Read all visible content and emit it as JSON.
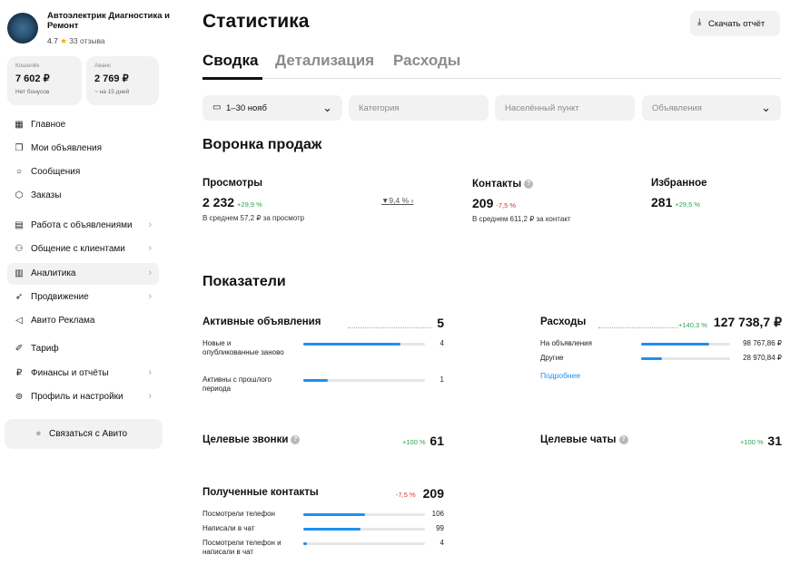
{
  "profile": {
    "name": "Автоэлектрик Диагностика и Ремонт",
    "rating": "4.7",
    "reviews": "33 отзыва"
  },
  "wallets": [
    {
      "label": "Кошелёк",
      "value": "7 602 ₽",
      "sub": "Нет бонусов"
    },
    {
      "label": "Аванс",
      "value": "2 769 ₽",
      "sub": "~ на 15 дней"
    }
  ],
  "nav": [
    {
      "label": "Главное",
      "icon": "grid-icon"
    },
    {
      "label": "Мои объявления",
      "icon": "ads-icon"
    },
    {
      "label": "Сообщения",
      "icon": "message-icon"
    },
    {
      "label": "Заказы",
      "icon": "box-icon"
    },
    {
      "label": "Работа с объявлениями",
      "icon": "work-icon"
    },
    {
      "label": "Общение с клиентами",
      "icon": "clients-icon"
    },
    {
      "label": "Аналитика",
      "icon": "analytics-icon"
    },
    {
      "label": "Продвижение",
      "icon": "rocket-icon"
    },
    {
      "label": "Авито Реклама",
      "icon": "megaphone-icon"
    },
    {
      "label": "Тариф",
      "icon": "tariff-icon"
    },
    {
      "label": "Финансы и отчёты",
      "icon": "ruble-icon"
    },
    {
      "label": "Профиль и настройки",
      "icon": "settings-icon"
    }
  ],
  "contact_button": "Связаться с Авито",
  "page_title": "Статистика",
  "download_button": "Скачать отчёт",
  "tabs": [
    "Сводка",
    "Детализация",
    "Расходы"
  ],
  "filters": {
    "period": "1–30 нояб",
    "category": "Категория",
    "locality": "Населённый пункт",
    "ads": "Объявления"
  },
  "funnel": {
    "title": "Воронка продаж",
    "views": {
      "label": "Просмотры",
      "value": "2 232",
      "delta": "+29,9 %",
      "sub": "В среднем 57,2 ₽ за просмотр"
    },
    "conversion": "9,4 %",
    "contacts": {
      "label": "Контакты",
      "value": "209",
      "delta": "-7,5 %",
      "sub": "В среднем 611,2 ₽ за контакт"
    },
    "favorites": {
      "label": "Избранное",
      "value": "281",
      "delta": "+29,5 %"
    }
  },
  "indicators": {
    "title": "Показатели",
    "active_ads": {
      "label": "Активные объявления",
      "value": "5",
      "rows": [
        {
          "label": "Новые и опубликованные заново",
          "value": "4",
          "fill": 0.8
        },
        {
          "label": "Активны с прошлого периода",
          "value": "1",
          "fill": 0.2
        }
      ]
    },
    "expenses": {
      "label": "Расходы",
      "delta": "+140,3 %",
      "value": "127 738,7 ₽",
      "rows": [
        {
          "label": "На объявления",
          "value": "98 767,86 ₽",
          "fill": 0.77
        },
        {
          "label": "Другие",
          "value": "28 970,84 ₽",
          "fill": 0.23
        }
      ],
      "more_link": "Подробнее"
    },
    "target_calls": {
      "label": "Целевые звонки",
      "delta": "+100 %",
      "value": "61"
    },
    "target_chats": {
      "label": "Целевые чаты",
      "delta": "+100 %",
      "value": "31"
    },
    "received_contacts": {
      "label": "Полученные контакты",
      "delta": "-7,5 %",
      "value": "209",
      "rows": [
        {
          "label": "Посмотрели телефон",
          "value": "106",
          "fill": 0.51
        },
        {
          "label": "Написали в чат",
          "value": "99",
          "fill": 0.47
        },
        {
          "label": "Посмотрели телефон и написали в чат",
          "value": "4",
          "fill": 0.03
        }
      ]
    }
  },
  "colors": {
    "accent": "#1e8ff0",
    "positive": "#2aa44f",
    "negative": "#e0333a",
    "surface": "#f2f2f3"
  }
}
